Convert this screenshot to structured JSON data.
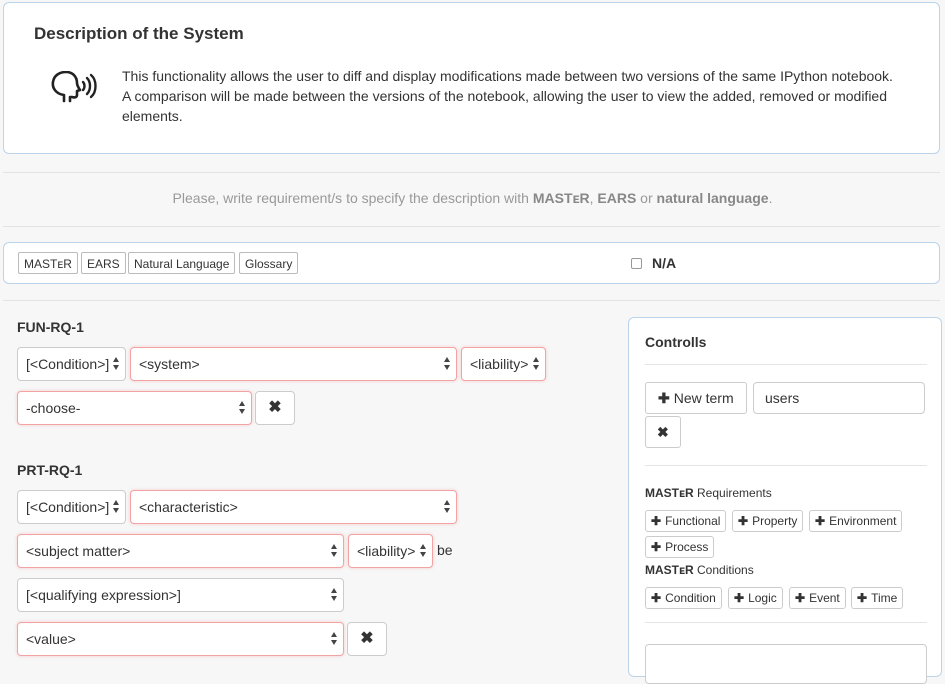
{
  "description": {
    "title": "Description of the System",
    "icon": "speaking-head-icon",
    "text": "This functionality allows the user to diff and display modifications made between two versions of the same IPython notebook. A comparison will be made between the versions of the notebook, allowing the user to view the added, removed or modified elements."
  },
  "prompt": {
    "before": "Please, write requirement/s to specify the description with ",
    "master": "MASTᴇR",
    "comma": ", ",
    "ears": "EARS",
    "or": " or ",
    "natural": "natural language",
    "period": "."
  },
  "tabs": [
    "MASTᴇR",
    "EARS",
    "Natural Language",
    "Glossary"
  ],
  "na_label": "N/A",
  "requirements": [
    {
      "id": "FUN-RQ-1",
      "fields": [
        "[<Condition>]",
        "<system>",
        "<liability>",
        "-choose-"
      ]
    },
    {
      "id": "PRT-RQ-1",
      "fields": [
        "[<Condition>]",
        "<characteristic>",
        "<subject matter>",
        "<liability>",
        "[<qualifying expression>]",
        "<value>"
      ],
      "be_text": "be"
    }
  ],
  "controls": {
    "title": "Controlls",
    "new_term_label": "New term",
    "term_value": "users",
    "master_requirements_brand": "MASTᴇR",
    "master_requirements_suffix": " Requirements",
    "requirement_buttons": [
      "Functional",
      "Property",
      "Environment",
      "Process"
    ],
    "master_conditions_brand": "MASTᴇR",
    "master_conditions_suffix": " Conditions",
    "condition_buttons": [
      "Condition",
      "Logic",
      "Event",
      "Time"
    ]
  },
  "colors": {
    "panel_border": "#bcd4ea",
    "invalid_border": "#f2a4a4",
    "muted_text": "#999999"
  }
}
